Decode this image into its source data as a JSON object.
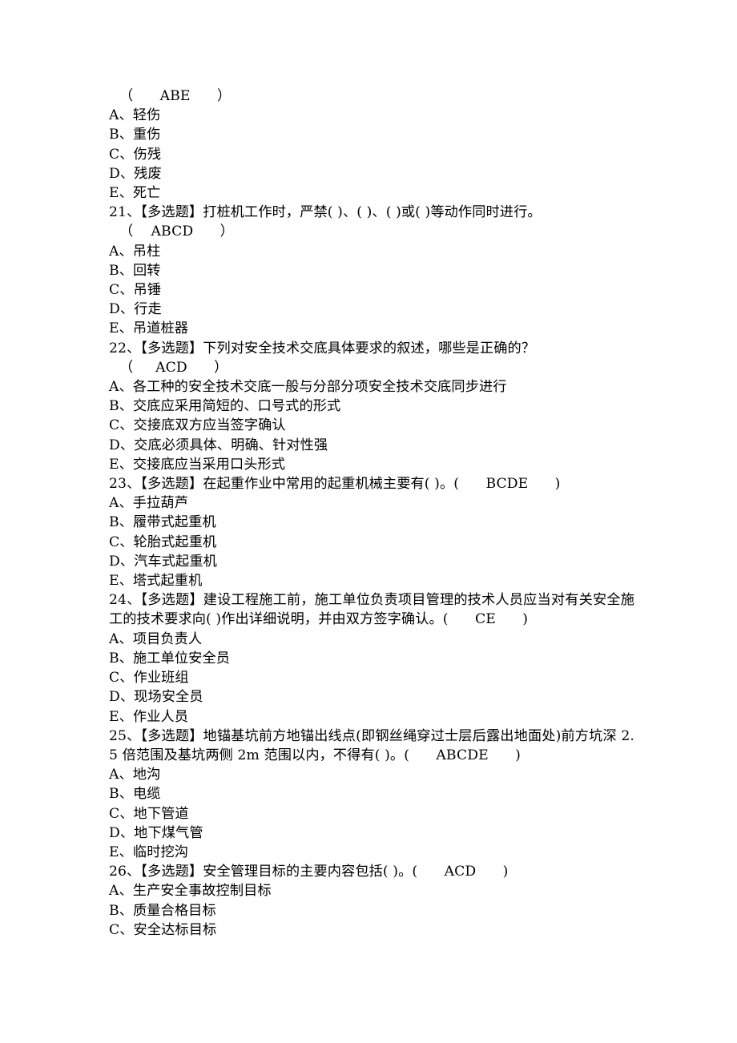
{
  "document": {
    "type": "exam-question-page",
    "language": "zh-CN",
    "background_color": "#ffffff",
    "text_color": "#000000",
    "question_tag": "【多选题】",
    "number_separator": "、"
  },
  "blocks": [
    {
      "kind": "answer",
      "text": "（      ABE      ）"
    },
    {
      "kind": "option",
      "text": "A、轻伤"
    },
    {
      "kind": "option",
      "text": "B、重伤"
    },
    {
      "kind": "option",
      "text": "C、伤残"
    },
    {
      "kind": "option",
      "text": "D、残废"
    },
    {
      "kind": "option",
      "text": "E、死亡"
    },
    {
      "kind": "question",
      "text": "21、【多选题】打桩机工作时，严禁( )、( )、( )或( )等动作同时进行。"
    },
    {
      "kind": "answer",
      "text": "（    ABCD      ）"
    },
    {
      "kind": "option",
      "text": "A、吊柱"
    },
    {
      "kind": "option",
      "text": "B、回转"
    },
    {
      "kind": "option",
      "text": "C、吊锤"
    },
    {
      "kind": "option",
      "text": "D、行走"
    },
    {
      "kind": "option",
      "text": "E、吊道桩器"
    },
    {
      "kind": "question",
      "text": "22、【多选题】下列对安全技术交底具体要求的叙述，哪些是正确的？"
    },
    {
      "kind": "answer",
      "text": "（     ACD      ）"
    },
    {
      "kind": "option",
      "text": "A、各工种的安全技术交底一般与分部分项安全技术交底同步进行"
    },
    {
      "kind": "option",
      "text": "B、交底应采用简短的、口号式的形式"
    },
    {
      "kind": "option",
      "text": "C、交接底双方应当签字确认"
    },
    {
      "kind": "option",
      "text": "D、交底必须具体、明确、针对性强"
    },
    {
      "kind": "option",
      "text": "E、交接底应当采用口头形式"
    },
    {
      "kind": "question",
      "text": "23、【多选题】在起重作业中常用的起重机械主要有( )。(      BCDE      )"
    },
    {
      "kind": "option",
      "text": "A、手拉葫芦"
    },
    {
      "kind": "option",
      "text": "B、履带式起重机"
    },
    {
      "kind": "option",
      "text": "C、轮胎式起重机"
    },
    {
      "kind": "option",
      "text": "D、汽车式起重机"
    },
    {
      "kind": "option",
      "text": "E、塔式起重机"
    },
    {
      "kind": "question",
      "text": "24、【多选题】建设工程施工前，施工单位负责项目管理的技术人员应当对有关安全施工的技术要求向( )作出详细说明，并由双方签字确认。(      CE      )"
    },
    {
      "kind": "option",
      "text": "A、项目负责人"
    },
    {
      "kind": "option",
      "text": "B、施工单位安全员"
    },
    {
      "kind": "option",
      "text": "C、作业班组"
    },
    {
      "kind": "option",
      "text": "D、现场安全员"
    },
    {
      "kind": "option",
      "text": "E、作业人员"
    },
    {
      "kind": "question",
      "text": "25、【多选题】地锚基坑前方地锚出线点(即钢丝绳穿过士层后露出地面处)前方坑深 2.5 倍范围及基坑两侧 2m 范围以内，不得有( )。(      ABCDE      )"
    },
    {
      "kind": "option",
      "text": "A、地沟"
    },
    {
      "kind": "option",
      "text": "B、电缆"
    },
    {
      "kind": "option",
      "text": "C、地下管道"
    },
    {
      "kind": "option",
      "text": "D、地下煤气管"
    },
    {
      "kind": "option",
      "text": "E、临时挖沟"
    },
    {
      "kind": "question",
      "text": "26、【多选题】安全管理目标的主要内容包括( )。(      ACD      )"
    },
    {
      "kind": "option",
      "text": "A、生产安全事故控制目标"
    },
    {
      "kind": "option",
      "text": "B、质量合格目标"
    },
    {
      "kind": "option",
      "text": "C、安全达标目标"
    }
  ]
}
